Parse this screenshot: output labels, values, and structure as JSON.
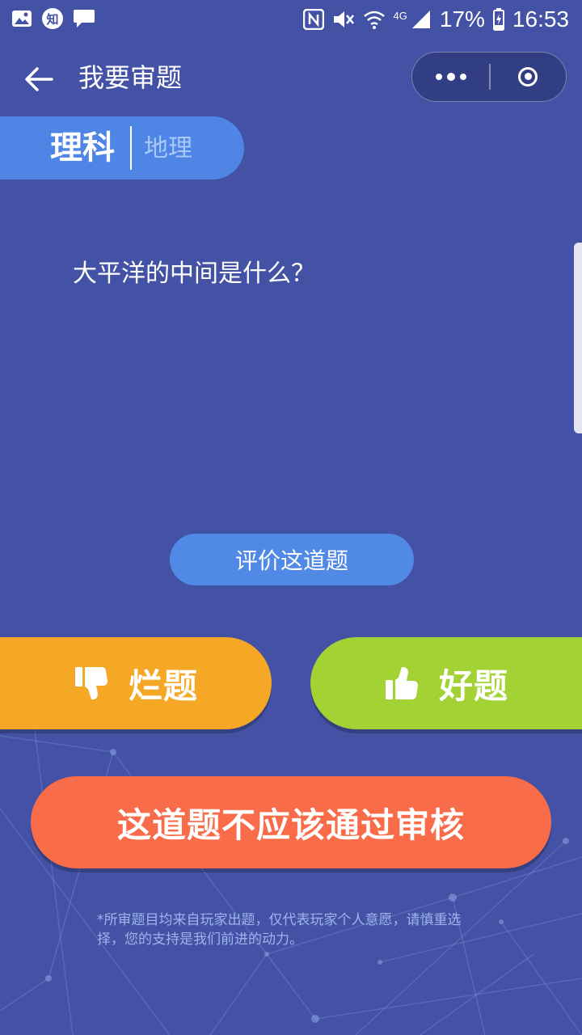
{
  "status_bar": {
    "notif_badge": "知",
    "net_type": "4G",
    "battery": "17%",
    "time": "16:53"
  },
  "nav": {
    "title": "我要审题"
  },
  "category": {
    "main": "理科",
    "sub": "地理"
  },
  "question": {
    "text": "大平洋的中间是什么？"
  },
  "rate_button": {
    "label": "评价这道题"
  },
  "vote": {
    "bad_label": "烂题",
    "good_label": "好题"
  },
  "reject_button": {
    "label": "这道题不应该通过审核"
  },
  "footnote": "*所审题目均来自玩家出题，仅代表玩家个人意愿，请慎重选择，您的支持是我们前进的动力。",
  "colors": {
    "background": "#4352a4",
    "accent_blue": "#4f86e6",
    "bad": "#f4a826",
    "good": "#a3d234",
    "reject": "#f96c4a"
  },
  "icons": [
    "image-icon",
    "zhihu-icon",
    "message-icon",
    "nfc-icon",
    "mute-icon",
    "wifi-icon",
    "signal-icon",
    "battery-icon",
    "back-arrow-icon",
    "more-dots-icon",
    "close-target-icon",
    "thumbs-down-icon",
    "thumbs-up-icon"
  ]
}
